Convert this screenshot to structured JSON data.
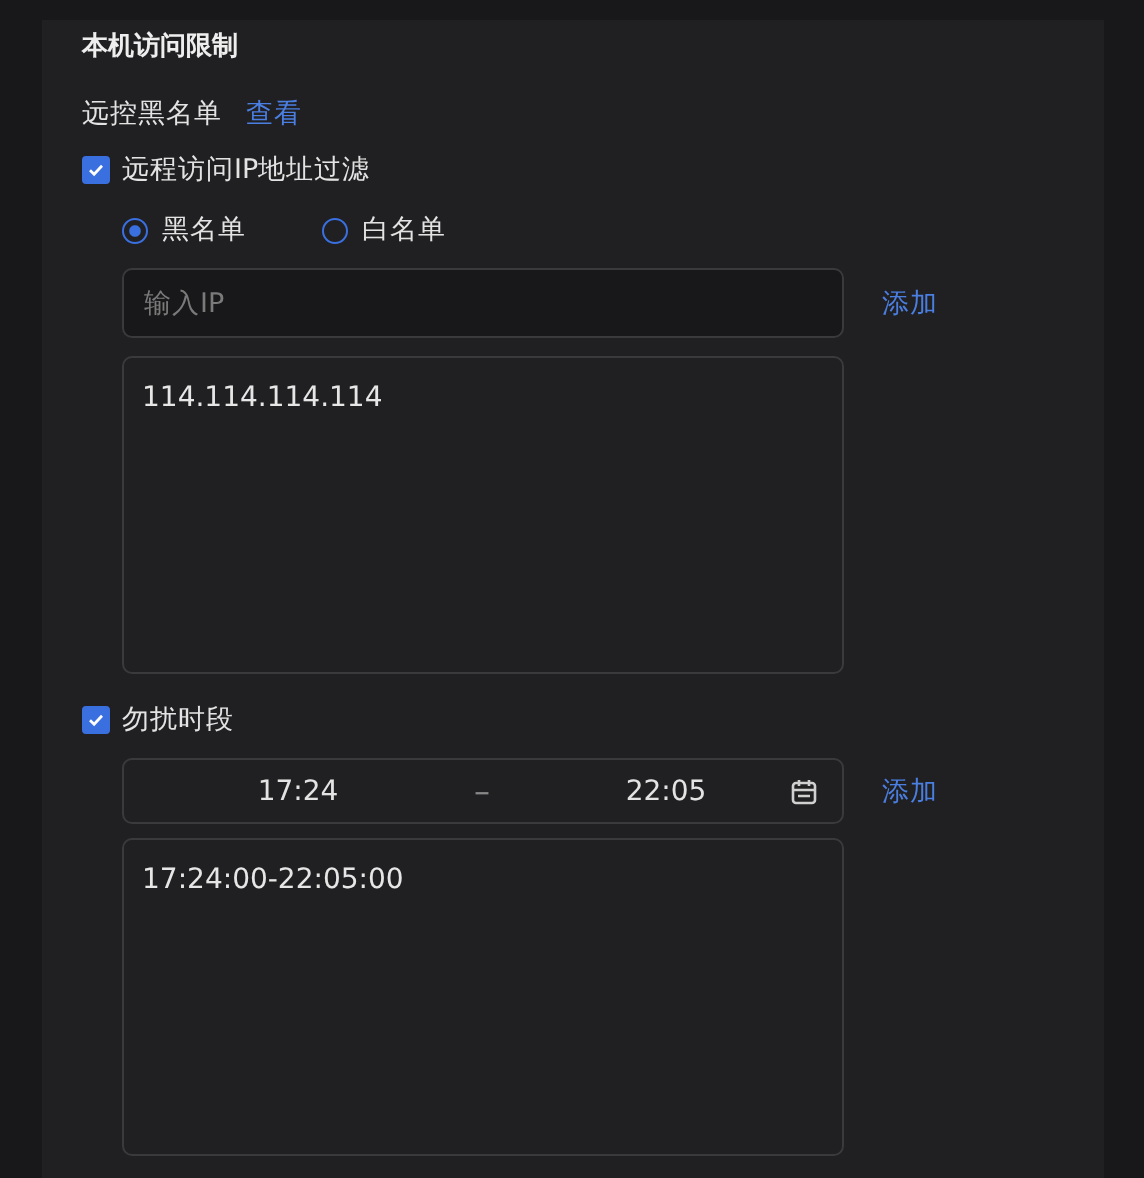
{
  "section": {
    "title": "本机访问限制"
  },
  "remote_blacklist": {
    "label": "远控黑名单",
    "link": "查看"
  },
  "ip_filter": {
    "label": "远程访问IP地址过滤",
    "checked": true,
    "modes": [
      {
        "label": "黑名单",
        "selected": true
      },
      {
        "label": "白名单",
        "selected": false
      }
    ],
    "input": {
      "placeholder": "输入IP"
    },
    "add": "添加",
    "entries": [
      "114.114.114.114"
    ]
  },
  "dnd": {
    "label": "勿扰时段",
    "checked": true,
    "start": "17:24",
    "separator": "–",
    "end": "22:05",
    "add": "添加",
    "entries": [
      "17:24:00-22:05:00"
    ]
  }
}
